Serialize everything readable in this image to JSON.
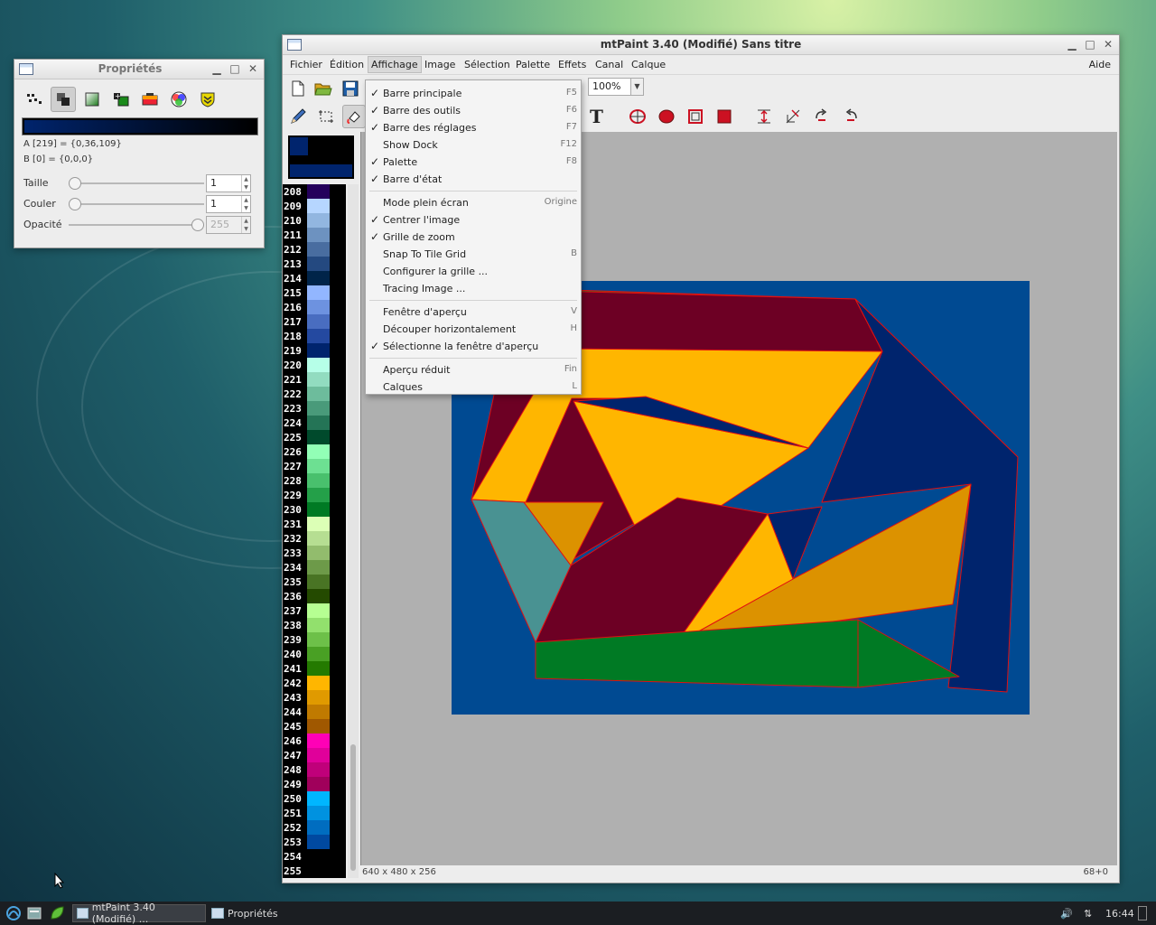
{
  "props_window": {
    "title": "Propriétés",
    "tools": [
      {
        "icon": "pattern-icon"
      },
      {
        "icon": "overlay-icon"
      },
      {
        "icon": "gradient-icon"
      },
      {
        "icon": "color-pick-icon"
      },
      {
        "icon": "palette-editor-icon"
      },
      {
        "icon": "color-wheel-icon"
      },
      {
        "icon": "shield-icon"
      }
    ],
    "color_a": "A [219] = {0,36,109}",
    "color_b": "B [0] = {0,0,0}",
    "size_label": "Taille",
    "size_value": "1",
    "flow_label": "Couler",
    "flow_value": "1",
    "opacity_label": "Opacité",
    "opacity_value": "255",
    "size_level": 0.0,
    "flow_level": 0.0,
    "opacity_level": 1.0
  },
  "main_window": {
    "title": "mtPaint 3.40 (Modifié) Sans titre",
    "menus": [
      "Fichier",
      "Édition",
      "Affichage",
      "Image",
      "Sélection",
      "Palette",
      "Effets",
      "Canal",
      "Calque"
    ],
    "help_menu": "Aide",
    "zoom": "100%",
    "status_left": "640 x 480 x 256",
    "status_right": "68+0"
  },
  "view_menu": {
    "groups": [
      [
        {
          "label": "Barre principale",
          "accel": "F5",
          "checked": true
        },
        {
          "label": "Barre des outils",
          "accel": "F6",
          "checked": true
        },
        {
          "label": "Barre des réglages",
          "accel": "F7",
          "checked": true
        },
        {
          "label": "Show Dock",
          "accel": "F12",
          "checked": false
        },
        {
          "label": "Palette",
          "accel": "F8",
          "checked": true
        },
        {
          "label": "Barre d'état",
          "accel": "",
          "checked": true
        }
      ],
      [
        {
          "label": "Mode plein écran",
          "accel": "Origine",
          "checked": false
        },
        {
          "label": "Centrer l'image",
          "accel": "",
          "checked": true
        },
        {
          "label": "Grille de zoom",
          "accel": "",
          "checked": true
        },
        {
          "label": "Snap To Tile Grid",
          "accel": "B",
          "checked": false
        },
        {
          "label": "Configurer la grille ...",
          "accel": "",
          "checked": false
        },
        {
          "label": "Tracing Image ...",
          "accel": "",
          "checked": false
        }
      ],
      [
        {
          "label": "Fenêtre d'aperçu",
          "accel": "V",
          "checked": false
        },
        {
          "label": "Découper horizontalement",
          "accel": "H",
          "checked": false
        },
        {
          "label": "Sélectionne la fenêtre d'aperçu",
          "accel": "",
          "checked": true
        }
      ],
      [
        {
          "label": "Aperçu réduit",
          "accel": "Fin",
          "checked": false
        },
        {
          "label": "Calques",
          "accel": "L",
          "checked": false
        }
      ]
    ]
  },
  "palette": {
    "entries": [
      {
        "n": "208",
        "c": "#24005b"
      },
      {
        "n": "209",
        "c": "#b6d6ff"
      },
      {
        "n": "210",
        "c": "#92b6e0"
      },
      {
        "n": "211",
        "c": "#6d92c0"
      },
      {
        "n": "212",
        "c": "#496da0"
      },
      {
        "n": "213",
        "c": "#244980"
      },
      {
        "n": "214",
        "c": "#002449"
      },
      {
        "n": "215",
        "c": "#92b6ff"
      },
      {
        "n": "216",
        "c": "#6d92e0"
      },
      {
        "n": "217",
        "c": "#496dc0"
      },
      {
        "n": "218",
        "c": "#2449a0"
      },
      {
        "n": "219",
        "c": "#00246d"
      },
      {
        "n": "220",
        "c": "#b6ffe8"
      },
      {
        "n": "221",
        "c": "#92dcc0"
      },
      {
        "n": "222",
        "c": "#6dbc9c"
      },
      {
        "n": "223",
        "c": "#499a7a"
      },
      {
        "n": "224",
        "c": "#247456"
      },
      {
        "n": "225",
        "c": "#004a2c"
      },
      {
        "n": "226",
        "c": "#92ffb6"
      },
      {
        "n": "227",
        "c": "#6de092"
      },
      {
        "n": "228",
        "c": "#49c06d"
      },
      {
        "n": "229",
        "c": "#24a049"
      },
      {
        "n": "230",
        "c": "#007a24"
      },
      {
        "n": "231",
        "c": "#dcffb6"
      },
      {
        "n": "232",
        "c": "#b6de92"
      },
      {
        "n": "233",
        "c": "#92bc6d"
      },
      {
        "n": "234",
        "c": "#6d9a49"
      },
      {
        "n": "235",
        "c": "#497424"
      },
      {
        "n": "236",
        "c": "#244a00"
      },
      {
        "n": "237",
        "c": "#b6ff92"
      },
      {
        "n": "238",
        "c": "#92e06d"
      },
      {
        "n": "239",
        "c": "#6dc049"
      },
      {
        "n": "240",
        "c": "#49a024"
      },
      {
        "n": "241",
        "c": "#247a00"
      },
      {
        "n": "242",
        "c": "#ffb600"
      },
      {
        "n": "243",
        "c": "#e09a00"
      },
      {
        "n": "244",
        "c": "#c07a00"
      },
      {
        "n": "245",
        "c": "#a05800"
      },
      {
        "n": "246",
        "c": "#ff00b6"
      },
      {
        "n": "247",
        "c": "#e0009a"
      },
      {
        "n": "248",
        "c": "#c0007a"
      },
      {
        "n": "249",
        "c": "#a0005b"
      },
      {
        "n": "250",
        "c": "#00b6ff"
      },
      {
        "n": "251",
        "c": "#0092e0"
      },
      {
        "n": "252",
        "c": "#006dc0"
      },
      {
        "n": "253",
        "c": "#0049a0"
      },
      {
        "n": "254",
        "c": "#000000"
      },
      {
        "n": "255",
        "c": "#000000"
      }
    ]
  },
  "taskbar": {
    "task1": "mtPaint 3.40 (Modifié) ...",
    "task2": "Propriétés",
    "clock": "16:44"
  },
  "colors": {
    "canvas_bg": "#004a92",
    "maroon": "#6d0024",
    "gold": "#ffb600",
    "green": "#007a24",
    "navy": "#00246d",
    "orange": "#dc9200",
    "teal": "#499292",
    "edge": "#ff0000"
  }
}
